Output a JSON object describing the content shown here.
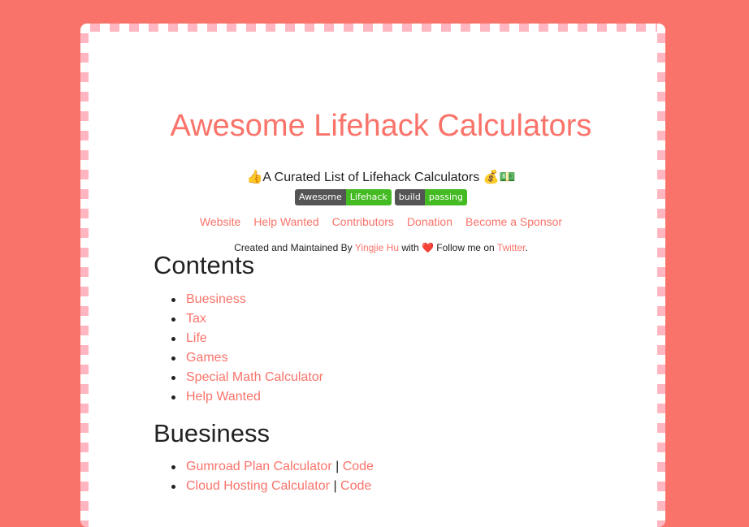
{
  "title": "Awesome Lifehack Calculators",
  "subtitle": {
    "lead_emoji": "👍",
    "text": "A Curated List of Lifehack Calculators",
    "trail_emoji": "💰💵"
  },
  "badges": [
    {
      "left": "Awesome",
      "right": "Lifehack",
      "right_color": "#44bb22"
    },
    {
      "left": "build",
      "right": "passing",
      "right_color": "#44bb22"
    }
  ],
  "nav": [
    "Website",
    "Help Wanted",
    "Contributors",
    "Donation",
    "Become a Sponsor"
  ],
  "credits": {
    "prefix": "Created and Maintained By ",
    "author": "Yingjie Hu",
    "with": " with ",
    "heart": "❤️",
    "follow": " Follow me on ",
    "twitter": "Twitter",
    "suffix": "."
  },
  "contents_heading": "Contents",
  "contents": [
    "Buesiness",
    "Tax",
    "Life",
    "Games",
    "Special Math Calculator",
    "Help Wanted"
  ],
  "business_heading": "Buesiness",
  "business": [
    {
      "name": "Gumroad Plan Calculator",
      "sep": "|",
      "code": "Code"
    },
    {
      "name": "Cloud Hosting Calculator",
      "sep": "|",
      "code": "Code"
    }
  ],
  "colors": {
    "background": "#fa736a",
    "accent": "#fa736a",
    "stripe": "#ffb6c1"
  }
}
